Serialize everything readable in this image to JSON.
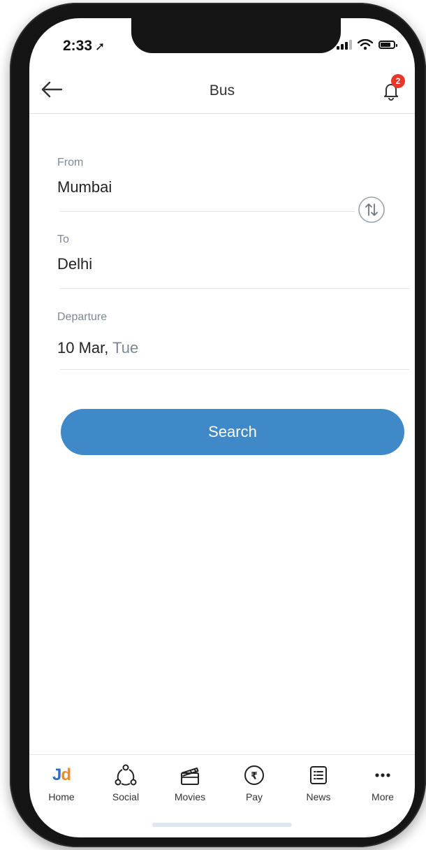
{
  "status_bar": {
    "time": "2:33"
  },
  "header": {
    "title": "Bus",
    "notification_count": "2"
  },
  "form": {
    "from": {
      "label": "From",
      "value": "Mumbai"
    },
    "to": {
      "label": "To",
      "value": "Delhi"
    },
    "departure": {
      "label": "Departure",
      "date": "10 Mar,",
      "day": "Tue"
    },
    "search_label": "Search"
  },
  "bottom_nav": [
    {
      "label": "Home",
      "icon": "jd-logo-icon",
      "logo_text": "Jd"
    },
    {
      "label": "Social",
      "icon": "social-icon"
    },
    {
      "label": "Movies",
      "icon": "clapperboard-icon"
    },
    {
      "label": "Pay",
      "icon": "rupee-icon"
    },
    {
      "label": "News",
      "icon": "news-icon"
    },
    {
      "label": "More",
      "icon": "more-dots-icon"
    }
  ],
  "colors": {
    "accent": "#3f89c9",
    "badge": "#e8362b",
    "jd_blue": "#2f6fc3",
    "jd_orange": "#f18a1f"
  }
}
